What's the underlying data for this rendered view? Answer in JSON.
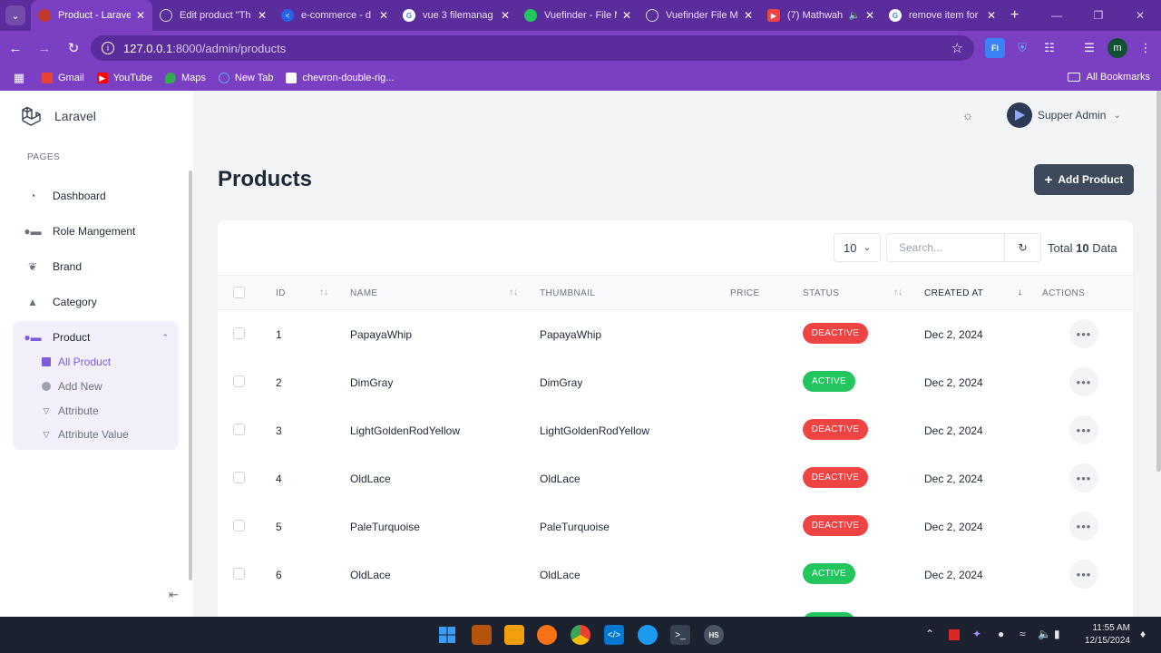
{
  "browser": {
    "tabs": [
      {
        "title": "Product - Laravel",
        "active": true,
        "favicon_color": "#c0392b"
      },
      {
        "title": "Edit product \"Th",
        "favicon_color": "#9ca3af"
      },
      {
        "title": "e-commerce - d",
        "favicon_color": "#2563eb"
      },
      {
        "title": "vue 3 filemanag",
        "favicon_color": "#ffffff"
      },
      {
        "title": "Vuefinder - File M",
        "favicon_color": "#22c55e"
      },
      {
        "title": "Vuefinder File M",
        "favicon_color": "#9ca3af"
      },
      {
        "title": "(7) Mathwah",
        "favicon_color": "#ef4444"
      },
      {
        "title": "remove item for",
        "favicon_color": "#ffffff"
      }
    ],
    "url_host": "127.0.0.1",
    "url_path": ":8000/admin/products",
    "bookmarks": [
      {
        "label": "Gmail",
        "color": "#ea4335"
      },
      {
        "label": "YouTube",
        "color": "#ff0000"
      },
      {
        "label": "Maps",
        "color": "#34a853"
      },
      {
        "label": "New Tab",
        "color": "#60a5fa"
      },
      {
        "label": "chevron-double-rig...",
        "color": "#ffffff"
      }
    ],
    "all_bookmarks": "All Bookmarks",
    "profile_initial": "m"
  },
  "sidebar": {
    "brand": "Laravel",
    "section_label": "PAGES",
    "items": [
      {
        "label": "Dashboard",
        "icon": "gauge-icon"
      },
      {
        "label": "Role Mangement",
        "icon": "users-icon"
      },
      {
        "label": "Brand",
        "icon": "leaf-icon"
      },
      {
        "label": "Category",
        "icon": "shapes-icon"
      },
      {
        "label": "Product",
        "icon": "user-group-icon"
      }
    ],
    "product_sub": [
      {
        "label": "All Product",
        "active": true
      },
      {
        "label": "Add New"
      },
      {
        "label": "Attribute"
      },
      {
        "label": "Attribute Value"
      }
    ]
  },
  "header": {
    "user_name": "Supper Admin"
  },
  "page": {
    "title": "Products",
    "add_button": "Add Product"
  },
  "table_controls": {
    "per_page": "10",
    "search_placeholder": "Search...",
    "total_prefix": "Total",
    "total_count": "10",
    "total_suffix": "Data"
  },
  "table": {
    "columns": [
      "ID",
      "NAME",
      "THUMBNAIL",
      "PRICE",
      "STATUS",
      "CREATED AT",
      "ACTIONS"
    ],
    "rows": [
      {
        "id": "1",
        "name": "PapayaWhip",
        "thumbnail": "PapayaWhip",
        "status": "DEACTIVE",
        "created": "Dec 2, 2024"
      },
      {
        "id": "2",
        "name": "DimGray",
        "thumbnail": "DimGray",
        "status": "ACTIVE",
        "created": "Dec 2, 2024"
      },
      {
        "id": "3",
        "name": "LightGoldenRodYellow",
        "thumbnail": "LightGoldenRodYellow",
        "status": "DEACTIVE",
        "created": "Dec 2, 2024"
      },
      {
        "id": "4",
        "name": "OldLace",
        "thumbnail": "OldLace",
        "status": "DEACTIVE",
        "created": "Dec 2, 2024"
      },
      {
        "id": "5",
        "name": "PaleTurquoise",
        "thumbnail": "PaleTurquoise",
        "status": "DEACTIVE",
        "created": "Dec 2, 2024"
      },
      {
        "id": "6",
        "name": "OldLace",
        "thumbnail": "OldLace",
        "status": "ACTIVE",
        "created": "Dec 2, 2024"
      }
    ]
  },
  "taskbar": {
    "time": "11:55 AM",
    "date": "12/15/2024"
  },
  "colors": {
    "browser_dark": "#5b2c9c",
    "browser_light": "#7b3fc4",
    "accent": "#7c5cdb",
    "deactive": "#ef4444",
    "active": "#22c55e",
    "primary_button": "#3d4a5c"
  }
}
